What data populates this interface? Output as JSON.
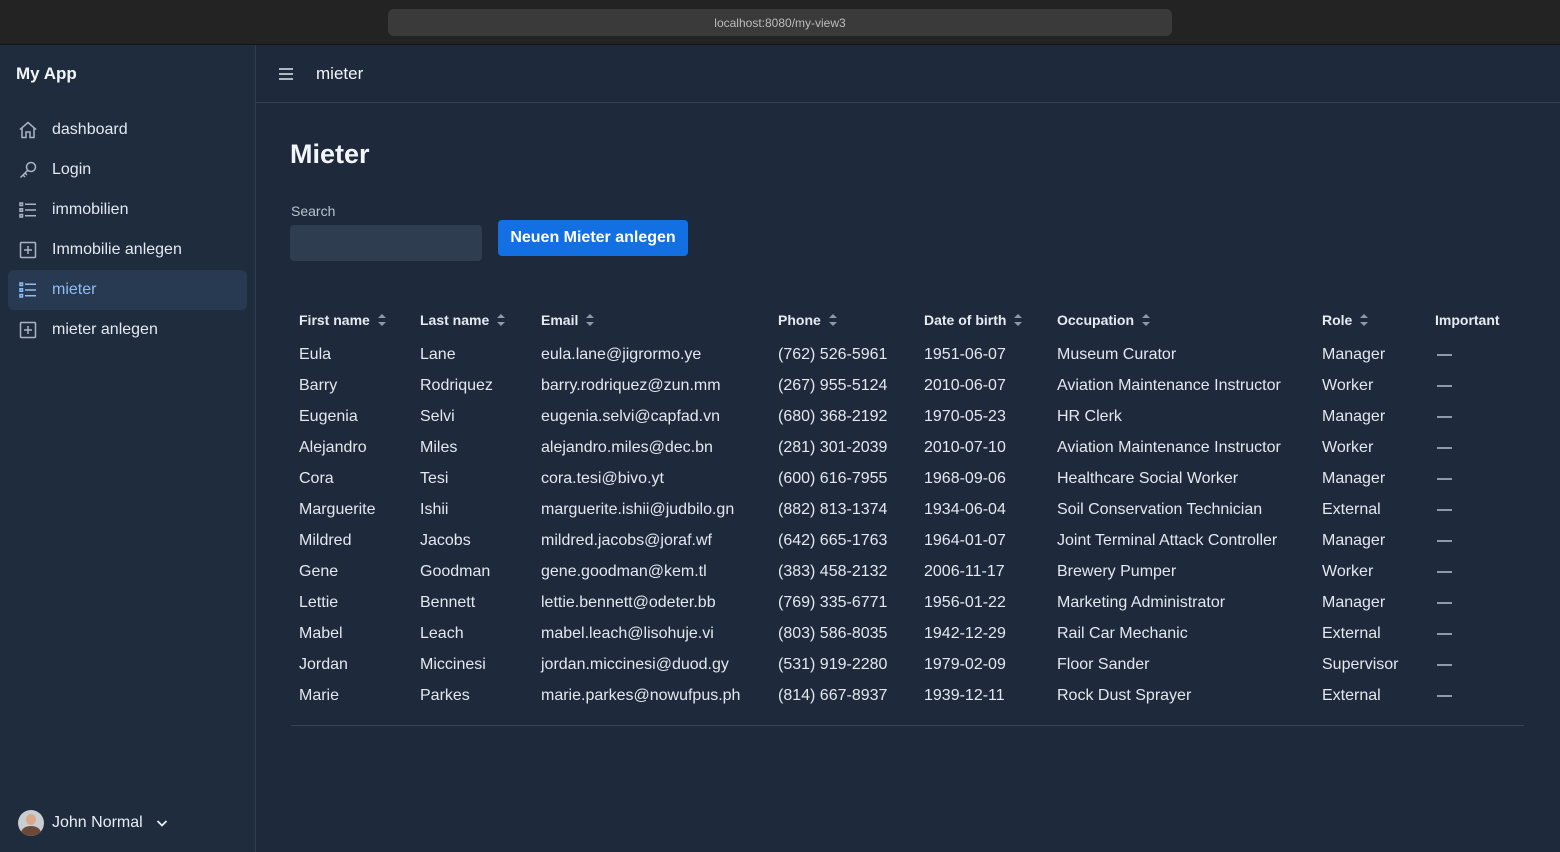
{
  "browser": {
    "url": "localhost:8080/my-view3"
  },
  "app": {
    "title": "My App"
  },
  "nav": {
    "items": [
      {
        "label": "dashboard",
        "icon": "home-icon"
      },
      {
        "label": "Login",
        "icon": "key-icon"
      },
      {
        "label": "immobilien",
        "icon": "list-icon"
      },
      {
        "label": "Immobilie anlegen",
        "icon": "plus-square-icon"
      },
      {
        "label": "mieter",
        "icon": "list-icon",
        "active": true
      },
      {
        "label": "mieter anlegen",
        "icon": "plus-square-icon"
      }
    ]
  },
  "user": {
    "name": "John Normal"
  },
  "header": {
    "title": "mieter"
  },
  "page": {
    "title": "Mieter",
    "search_label": "Search",
    "search_value": "",
    "new_button": "Neuen  Mieter anlegen"
  },
  "table": {
    "columns": [
      "First name",
      "Last name",
      "Email",
      "Phone",
      "Date of birth",
      "Occupation",
      "Role",
      "Important"
    ],
    "rows": [
      [
        "Eula",
        "Lane",
        "eula.lane@jigrormo.ye",
        "(762) 526-5961",
        "1951-06-07",
        "Museum Curator",
        "Manager"
      ],
      [
        "Barry",
        "Rodriquez",
        "barry.rodriquez@zun.mm",
        "(267) 955-5124",
        "2010-06-07",
        "Aviation Maintenance Instructor",
        "Worker"
      ],
      [
        "Eugenia",
        "Selvi",
        "eugenia.selvi@capfad.vn",
        "(680) 368-2192",
        "1970-05-23",
        "HR Clerk",
        "Manager"
      ],
      [
        "Alejandro",
        "Miles",
        "alejandro.miles@dec.bn",
        "(281) 301-2039",
        "2010-07-10",
        "Aviation Maintenance Instructor",
        "Worker"
      ],
      [
        "Cora",
        "Tesi",
        "cora.tesi@bivo.yt",
        "(600) 616-7955",
        "1968-09-06",
        "Healthcare Social Worker",
        "Manager"
      ],
      [
        "Marguerite",
        "Ishii",
        "marguerite.ishii@judbilo.gn",
        "(882) 813-1374",
        "1934-06-04",
        "Soil Conservation Technician",
        "External"
      ],
      [
        "Mildred",
        "Jacobs",
        "mildred.jacobs@joraf.wf",
        "(642) 665-1763",
        "1964-01-07",
        "Joint Terminal Attack Controller",
        "Manager"
      ],
      [
        "Gene",
        "Goodman",
        "gene.goodman@kem.tl",
        "(383) 458-2132",
        "2006-11-17",
        "Brewery Pumper",
        "Worker"
      ],
      [
        "Lettie",
        "Bennett",
        "lettie.bennett@odeter.bb",
        "(769) 335-6771",
        "1956-01-22",
        "Marketing Administrator",
        "Manager"
      ],
      [
        "Mabel",
        "Leach",
        "mabel.leach@lisohuje.vi",
        "(803) 586-8035",
        "1942-12-29",
        "Rail Car Mechanic",
        "External"
      ],
      [
        "Jordan",
        "Miccinesi",
        "jordan.miccinesi@duod.gy",
        "(531) 919-2280",
        "1979-02-09",
        "Floor Sander",
        "Supervisor"
      ],
      [
        "Marie",
        "Parkes",
        "marie.parkes@nowufpus.ph",
        "(814) 667-8937",
        "1939-12-11",
        "Rock Dust Sprayer",
        "External"
      ]
    ]
  }
}
